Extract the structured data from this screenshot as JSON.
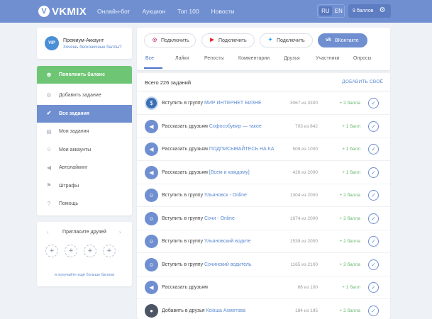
{
  "header": {
    "logo_glyph": "V",
    "logo_text": "VKMIX",
    "nav": [
      "Онлайн-бот",
      "Аукцион",
      "Топ 100",
      "Новости"
    ],
    "langs": [
      "RU",
      "EN"
    ],
    "active_lang": "RU",
    "balance": "9 баллов"
  },
  "premium": {
    "badge": "VIP",
    "title": "Премиум-Аккаунт",
    "link": "Хочешь бесконечные баллы?"
  },
  "menu": [
    {
      "label": "Пополнить баланс",
      "icon": "plus-circle-icon",
      "glyph": "⊕",
      "style": "green"
    },
    {
      "label": "Добавить задание",
      "icon": "gear-icon",
      "glyph": "⚙",
      "style": ""
    },
    {
      "label": "Все задания",
      "icon": "check-circle-icon",
      "glyph": "✔",
      "style": "active"
    },
    {
      "label": "Мои задания",
      "icon": "document-icon",
      "glyph": "▤",
      "style": ""
    },
    {
      "label": "Мои аккаунты",
      "icon": "user-icon",
      "glyph": "☺",
      "style": ""
    },
    {
      "label": "Автолайкинг",
      "icon": "megaphone-icon",
      "glyph": "◀",
      "style": ""
    },
    {
      "label": "Штрафы",
      "icon": "flag-icon",
      "glyph": "⚑",
      "style": ""
    },
    {
      "label": "Помощь",
      "icon": "help-icon",
      "glyph": "?",
      "style": ""
    }
  ],
  "invite": {
    "title": "Пригласите друзей",
    "slot_glyph": "+",
    "note": "и получайте ещё больше баллов"
  },
  "social": [
    {
      "label": "Подключить",
      "icon": "instagram-icon",
      "glyph": "◎",
      "color": "#c13584"
    },
    {
      "label": "Подключить",
      "icon": "youtube-icon",
      "glyph": "▶",
      "color": "#e62117"
    },
    {
      "label": "Подключить",
      "icon": "twitter-icon",
      "glyph": "✦",
      "color": "#1da1f2"
    },
    {
      "label": "ВКонтакте",
      "icon": "vk-icon",
      "glyph": "vk",
      "color": "#ffffff"
    }
  ],
  "tabs": [
    "Все",
    "Лайки",
    "Репосты",
    "Комментарии",
    "Друзья",
    "Участники",
    "Опросы"
  ],
  "tasks": {
    "total": "Всего 226 заданий",
    "add_own": "ДОБАВИТЬ СВОЁ",
    "rows": [
      {
        "action": "Вступить в группу",
        "target": "МИР ИНТЕРНЕТ БИЗНЕ",
        "count": "3067 из 3300",
        "points": "+ 2 балла",
        "icon": "group-logo-icon",
        "glyph": "$",
        "kind": "logo"
      },
      {
        "action": "Рассказать друзьям",
        "target": "Софособувир — такое",
        "count": "703 из 842",
        "points": "+ 1 балл",
        "icon": "megaphone-icon",
        "glyph": "◀",
        "kind": ""
      },
      {
        "action": "Рассказать друзьям",
        "target": "ПОДПИСЫВАЙТЕСЬ НА КА",
        "count": "509 из 1000",
        "points": "+ 1 балл",
        "icon": "megaphone-icon",
        "glyph": "◀",
        "kind": ""
      },
      {
        "action": "Рассказать друзьям",
        "target": "[Всем и каждому]",
        "count": "426 из 2000",
        "points": "+ 1 балл",
        "icon": "megaphone-icon",
        "glyph": "◀",
        "kind": ""
      },
      {
        "action": "Вступить в группу",
        "target": "Ульяновск - Online",
        "count": "1304 из 2000",
        "points": "+ 2 балла",
        "icon": "user-icon",
        "glyph": "☺",
        "kind": ""
      },
      {
        "action": "Вступить в группу",
        "target": "Сочи - Online",
        "count": "1674 из 2000",
        "points": "+ 2 балла",
        "icon": "user-icon",
        "glyph": "☺",
        "kind": ""
      },
      {
        "action": "Вступить в группу",
        "target": "Ульяновский водите",
        "count": "1539 из 2000",
        "points": "+ 2 балла",
        "icon": "user-icon",
        "glyph": "☺",
        "kind": ""
      },
      {
        "action": "Вступить в группу",
        "target": "Сочинский водитель",
        "count": "1165 из 2100",
        "points": "+ 2 балла",
        "icon": "user-icon",
        "glyph": "☺",
        "kind": ""
      },
      {
        "action": "Рассказать друзьям",
        "target": "",
        "count": "66 из 100",
        "points": "+ 1 балл",
        "icon": "megaphone-icon",
        "glyph": "◀",
        "kind": ""
      },
      {
        "action": "Добавить в друзья",
        "target": "Ксюша Ахметова",
        "count": "184 из 195",
        "points": "+ 2 балла",
        "icon": "avatar-icon",
        "glyph": "●",
        "kind": "dark"
      }
    ]
  },
  "check_glyph": "✓"
}
